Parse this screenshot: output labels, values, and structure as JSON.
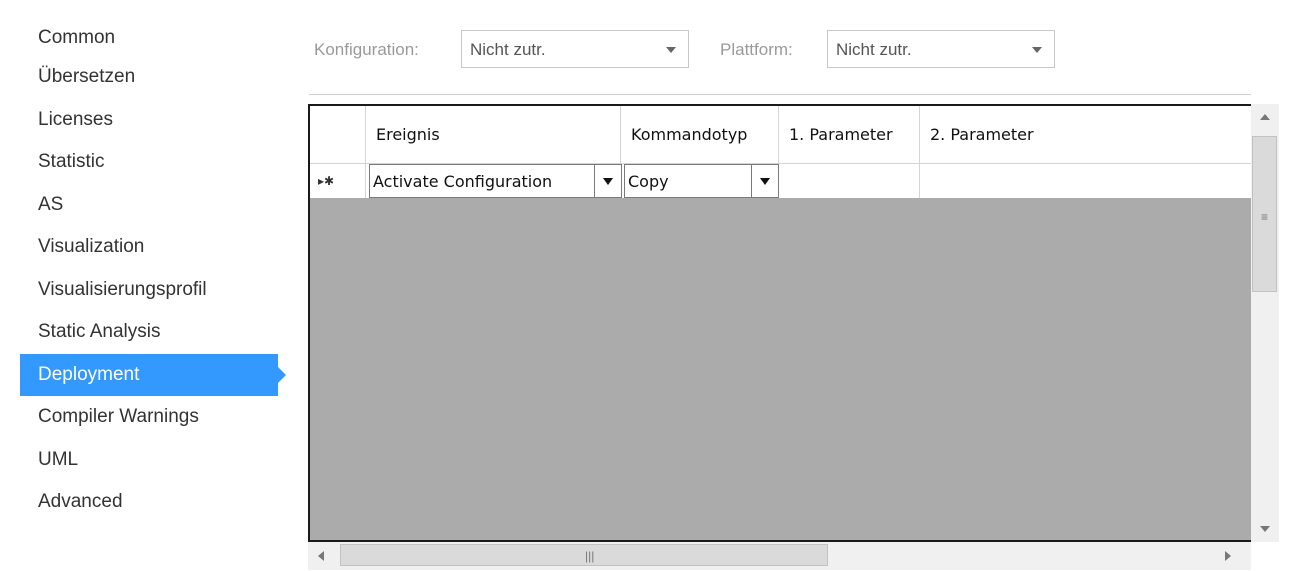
{
  "sidebar": {
    "items": [
      {
        "label": "Common"
      },
      {
        "label": "Übersetzen"
      },
      {
        "label": "Licenses"
      },
      {
        "label": "Statistic"
      },
      {
        "label": "AS"
      },
      {
        "label": "Visualization"
      },
      {
        "label": "Visualisierungsprofil"
      },
      {
        "label": "Static Analysis"
      },
      {
        "label": "Deployment",
        "selected": true
      },
      {
        "label": "Compiler Warnings"
      },
      {
        "label": "UML"
      },
      {
        "label": "Advanced"
      }
    ]
  },
  "toolbar": {
    "config_label": "Konfiguration:",
    "config_value": "Nicht zutr.",
    "platform_label": "Plattform:",
    "platform_value": "Nicht zutr."
  },
  "grid": {
    "columns": [
      "Ereignis",
      "Kommandotyp",
      "1. Parameter",
      "2. Parameter"
    ],
    "new_row": {
      "marker": "▸✱",
      "event": "Activate Configuration",
      "command_type": "Copy",
      "param1": "",
      "param2": ""
    }
  },
  "colors": {
    "accent": "#3399ff",
    "grid_background": "#ababab"
  },
  "icons": {
    "v_grip": "≡",
    "h_grip": "|||"
  }
}
